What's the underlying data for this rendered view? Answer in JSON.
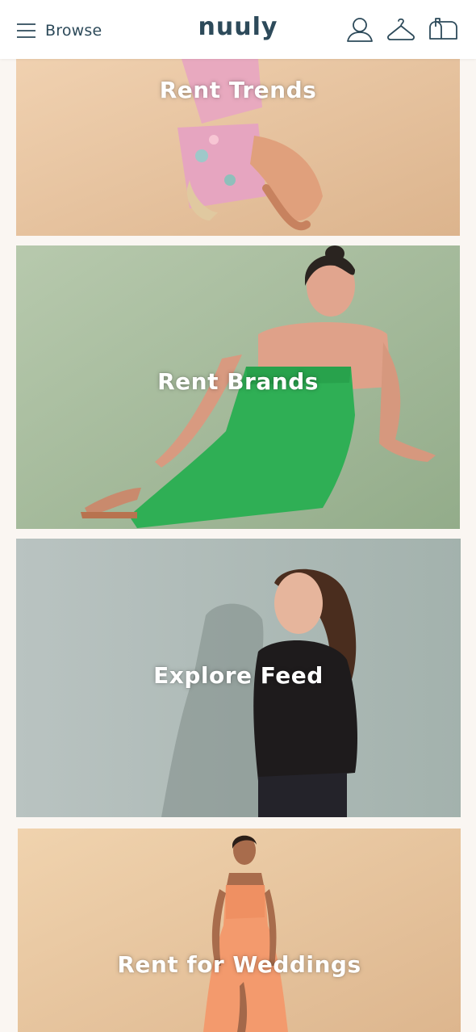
{
  "header": {
    "browse_label": "Browse",
    "logo_text": "nuuly",
    "icons": [
      "menu-icon",
      "account-icon",
      "hanger-icon",
      "mailbox-icon"
    ],
    "brand_color": "#2d4a5a"
  },
  "tiles": [
    {
      "label": "Rent Trends",
      "bg_color": "#e6c7a6"
    },
    {
      "label": "Rent Brands",
      "bg_color": "#a9bea0"
    },
    {
      "label": "Explore Feed",
      "bg_color": "#aab7b3"
    },
    {
      "label": "Rent for Weddings",
      "bg_color": "#eccba2"
    }
  ]
}
